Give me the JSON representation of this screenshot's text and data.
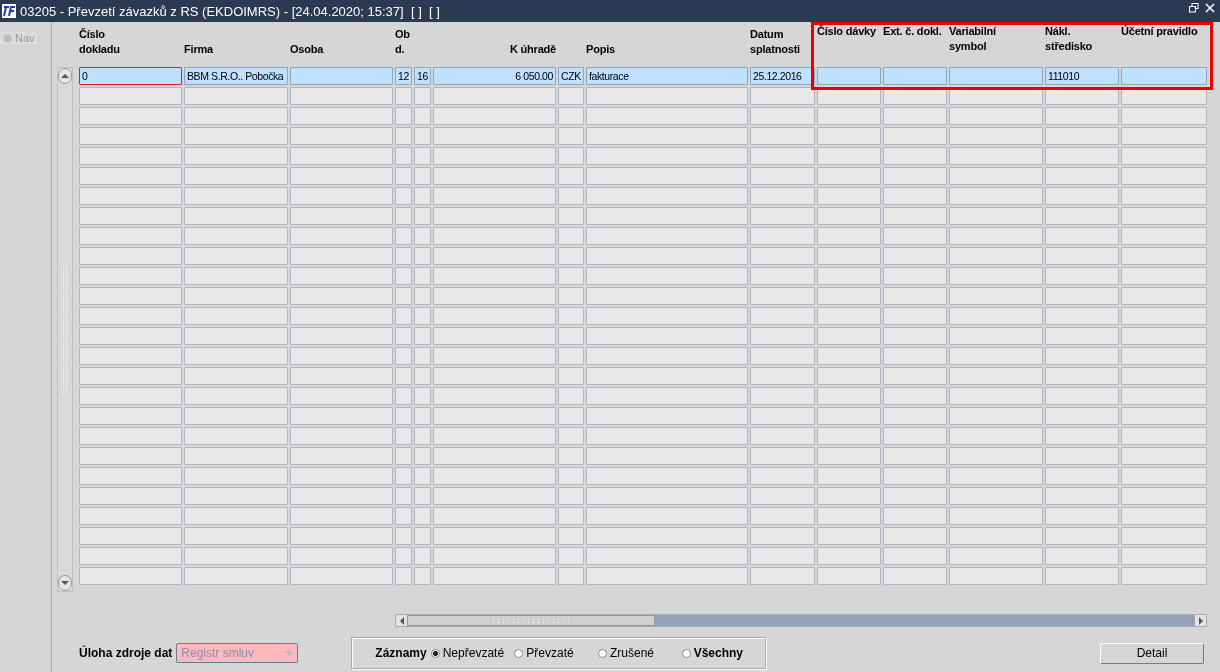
{
  "window": {
    "title": "03205 - Převzetí závazků z RS (EKDOIMRS) - [24.04.2020; 15:37]  [ ]  [ ]"
  },
  "nav": {
    "label": "Nav",
    "disabled": true
  },
  "table": {
    "columns": [
      {
        "label": [
          "Číslo",
          "dokladu"
        ]
      },
      {
        "label": [
          "Firma"
        ]
      },
      {
        "label": [
          "Osoba"
        ]
      },
      {
        "label": [
          "Ob",
          "d."
        ]
      },
      null,
      {
        "label": [
          "K úhradě"
        ]
      },
      null,
      {
        "label": [
          "Popis"
        ]
      },
      {
        "label": [
          "Datum",
          "splatnosti"
        ]
      },
      {
        "label": [
          "Číslo dávky"
        ]
      },
      {
        "label": [
          "Ext. č. dokl."
        ]
      },
      {
        "label": [
          "Variabilní",
          "symbol"
        ]
      },
      {
        "label": [
          "Nákl.",
          "středisko"
        ]
      },
      {
        "label": [
          "Účetní pravidlo"
        ]
      }
    ],
    "rows": [
      {
        "selected": true,
        "cells": [
          "0",
          "BBM S.R.O.. Pobočka",
          null,
          "12",
          "16",
          "6 050.00",
          "CZK",
          "fakturace",
          "25.12.2016",
          null,
          null,
          null,
          "111010",
          null
        ]
      },
      {
        "selected": false
      },
      {
        "selected": false
      },
      {
        "selected": false
      },
      {
        "selected": false
      },
      {
        "selected": false
      },
      {
        "selected": false
      },
      {
        "selected": false
      },
      {
        "selected": false
      },
      {
        "selected": false
      },
      {
        "selected": false
      },
      {
        "selected": false
      },
      {
        "selected": false
      },
      {
        "selected": false
      },
      {
        "selected": false
      },
      {
        "selected": false
      },
      {
        "selected": false
      },
      {
        "selected": false
      },
      {
        "selected": false
      },
      {
        "selected": false
      },
      {
        "selected": false
      },
      {
        "selected": false
      },
      {
        "selected": false
      },
      {
        "selected": false
      },
      {
        "selected": false
      },
      {
        "selected": false
      }
    ]
  },
  "source": {
    "label": "Úloha zdroje dat",
    "value": "Registr smluv",
    "disabled": true
  },
  "records": {
    "label": "Záznamy",
    "options": [
      {
        "label": "Nepřevzaté",
        "selected": true,
        "bold": false
      },
      {
        "label": "Převzaté",
        "selected": false,
        "bold": false
      },
      {
        "label": "Zrušené",
        "selected": false,
        "bold": false
      },
      {
        "label": "Všechny",
        "selected": false,
        "bold": true
      }
    ]
  },
  "buttons": [
    "Detail"
  ]
}
